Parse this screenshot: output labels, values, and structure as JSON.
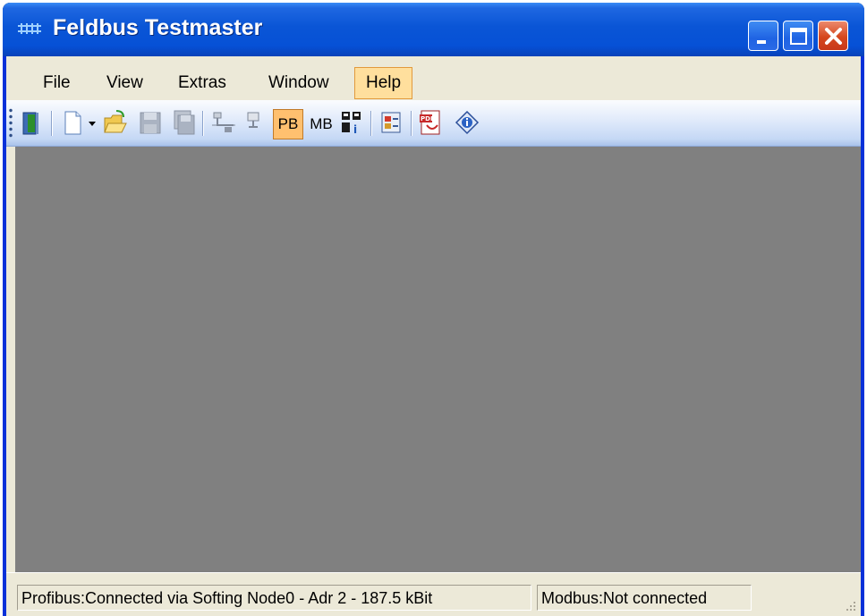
{
  "window": {
    "title": "Feldbus Testmaster",
    "app_icon": "feldbus-logo-icon"
  },
  "menu": {
    "file": "File",
    "view": "View",
    "extras": "Extras",
    "window": "Window",
    "help": "Help"
  },
  "toolbar": {
    "pb_label": "PB",
    "mb_label": "MB",
    "icons": [
      "exit-door-icon",
      "new-document-icon",
      "dropdown-arrow-icon",
      "open-folder-icon",
      "save-icon",
      "save-all-icon",
      "network-connect-icon",
      "network-disconnect-icon",
      "pb-toggle",
      "mb-toggle",
      "device-config-icon",
      "slave-config-icon",
      "pdf-manual-icon",
      "about-info-icon"
    ]
  },
  "status": {
    "profibus": "Profibus:Connected via Softing Node0 - Adr 2 - 187.5 kBit",
    "modbus": "Modbus:Not connected"
  },
  "colors": {
    "titlebar": "#0a55d6",
    "mdi_background": "#808080",
    "menu_highlight": "#ffdf9d",
    "checked_button": "#ffc06f"
  }
}
